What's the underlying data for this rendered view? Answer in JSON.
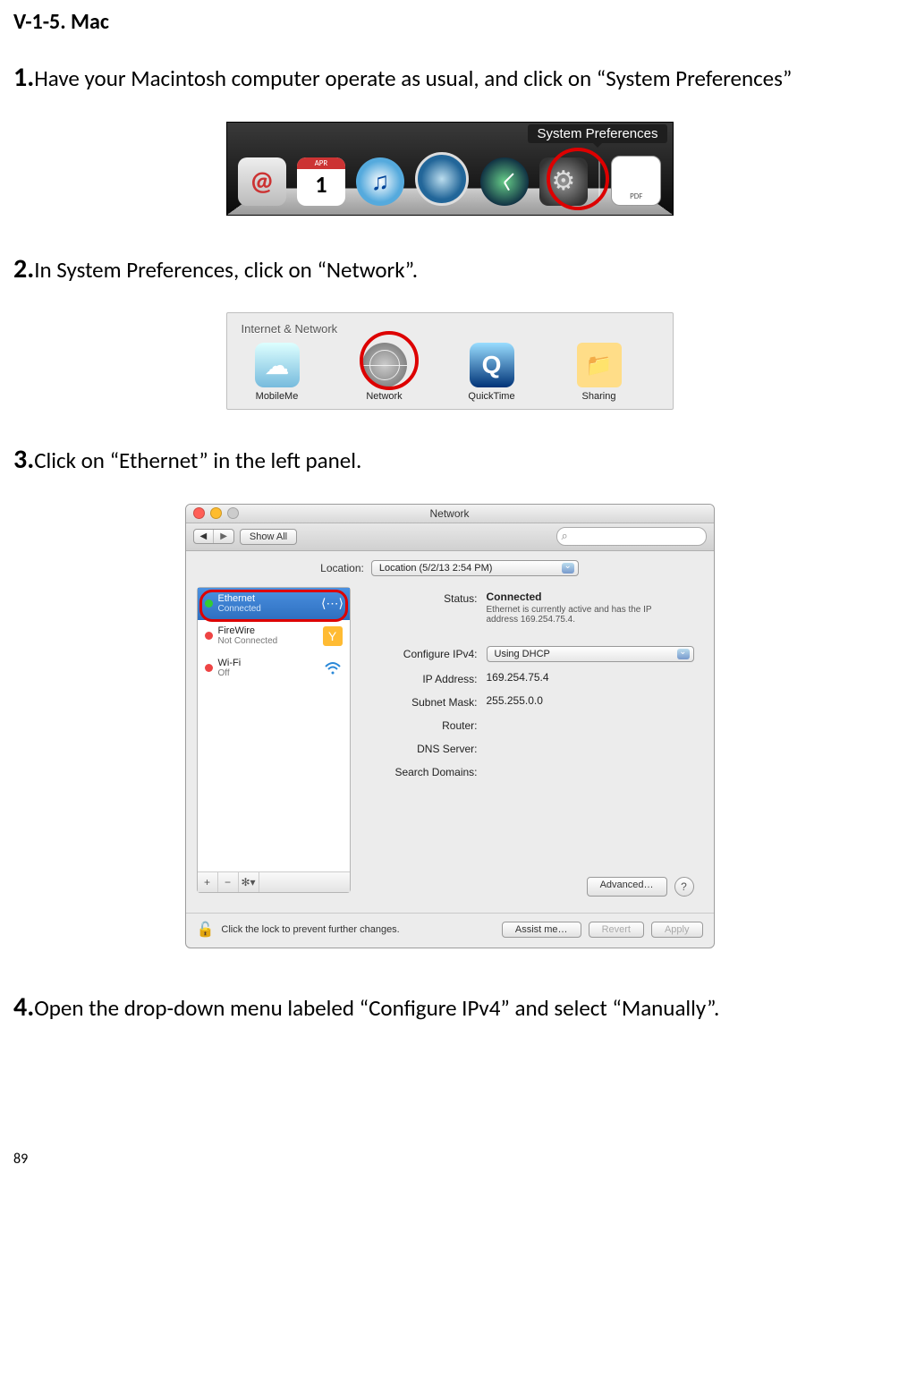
{
  "page": {
    "heading": "V-1-5.    Mac",
    "number": "89"
  },
  "steps": [
    "Have your Macintosh computer operate as usual, and click on “System Preferences”",
    "In System Preferences, click on “Network”.",
    "Click on “Ethernet” in the left panel.",
    "Open the drop-down menu labeled “Configure IPv4” and select “Manually”."
  ],
  "dock": {
    "tooltip": "System Preferences"
  },
  "prefrow": {
    "section": "Internet & Network",
    "items": [
      "MobileMe",
      "Network",
      "QuickTime",
      "Sharing"
    ]
  },
  "network": {
    "title": "Network",
    "showall": "Show All",
    "location_label": "Location:",
    "location_value": "Location (5/2/13 2:54 PM)",
    "services": [
      {
        "name": "Ethernet",
        "status": "Connected"
      },
      {
        "name": "FireWire",
        "status": "Not Connected"
      },
      {
        "name": "Wi-Fi",
        "status": "Off"
      }
    ],
    "labels": {
      "status": "Status:",
      "config": "Configure IPv4:",
      "ip": "IP Address:",
      "mask": "Subnet Mask:",
      "router": "Router:",
      "dns": "DNS Server:",
      "search": "Search Domains:"
    },
    "values": {
      "status": "Connected",
      "status_sub": "Ethernet is currently active and has the IP address 169.254.75.4.",
      "config": "Using DHCP",
      "ip": "169.254.75.4",
      "mask": "255.255.0.0",
      "router": "",
      "dns": "",
      "search": ""
    },
    "buttons": {
      "advanced": "Advanced…",
      "help": "?",
      "assist": "Assist me…",
      "revert": "Revert",
      "apply": "Apply"
    },
    "lock_text": "Click the lock to prevent further changes."
  }
}
